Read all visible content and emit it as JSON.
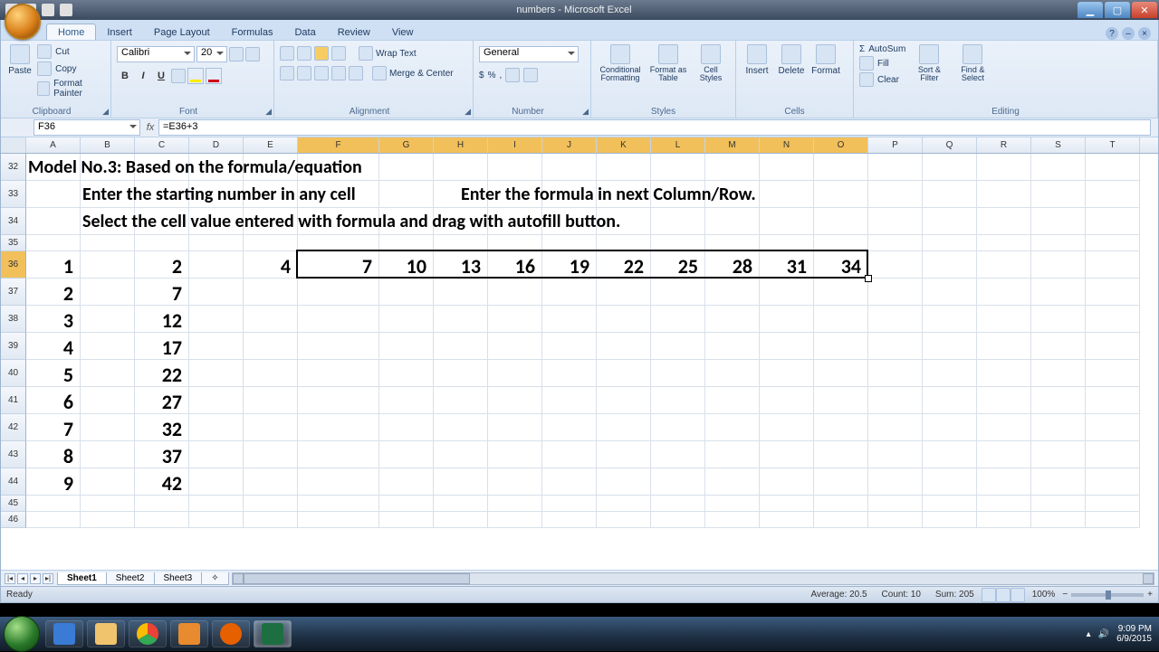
{
  "window": {
    "title_doc": "numbers",
    "title_app": "Microsoft Excel"
  },
  "ribbon": {
    "tabs": [
      "Home",
      "Insert",
      "Page Layout",
      "Formulas",
      "Data",
      "Review",
      "View"
    ],
    "active": "Home",
    "clipboard": {
      "label": "Clipboard",
      "paste": "Paste",
      "cut": "Cut",
      "copy": "Copy",
      "fpainter": "Format Painter"
    },
    "font": {
      "label": "Font",
      "name": "Calibri",
      "size": "20"
    },
    "alignment": {
      "label": "Alignment",
      "wrap": "Wrap Text",
      "merge": "Merge & Center"
    },
    "number": {
      "label": "Number",
      "format": "General"
    },
    "styles": {
      "label": "Styles",
      "cond": "Conditional Formatting",
      "ftable": "Format as Table",
      "cstyles": "Cell Styles"
    },
    "cells": {
      "label": "Cells",
      "insert": "Insert",
      "delete": "Delete",
      "format": "Format"
    },
    "editing": {
      "label": "Editing",
      "autosum": "AutoSum",
      "fill": "Fill",
      "clear": "Clear",
      "sort": "Sort & Filter",
      "find": "Find & Select"
    }
  },
  "formula_bar": {
    "name_box": "F36",
    "formula": "=E36+3"
  },
  "columns": [
    "A",
    "B",
    "C",
    "D",
    "E",
    "F",
    "G",
    "H",
    "I",
    "J",
    "K",
    "L",
    "M",
    "N",
    "O",
    "P",
    "Q",
    "R",
    "S",
    "T"
  ],
  "rows": [
    "32",
    "33",
    "34",
    "35",
    "36",
    "37",
    "38",
    "39",
    "40",
    "41",
    "42",
    "43",
    "44",
    "45",
    "46"
  ],
  "content": {
    "heading": "Model No.3: Based on the formula/equation",
    "line1a": "Enter the starting number in any cell",
    "line1b": "Enter the formula in next Column/Row.",
    "line2": "Select the cell value entered with formula and drag with autofill button.",
    "colA": [
      "1",
      "2",
      "3",
      "4",
      "5",
      "6",
      "7",
      "8",
      "9"
    ],
    "colC": [
      "2",
      "7",
      "12",
      "17",
      "22",
      "27",
      "32",
      "37",
      "42"
    ],
    "rowE": "4",
    "rowSeries": [
      "7",
      "10",
      "13",
      "16",
      "19",
      "22",
      "25",
      "28",
      "31",
      "34"
    ]
  },
  "sheets": [
    "Sheet1",
    "Sheet2",
    "Sheet3"
  ],
  "statusbar": {
    "mode": "Ready",
    "avg": "Average: 20.5",
    "count": "Count: 10",
    "sum": "Sum: 205",
    "zoom": "100%"
  },
  "tray": {
    "time": "9:09 PM",
    "date": "6/9/2015"
  }
}
